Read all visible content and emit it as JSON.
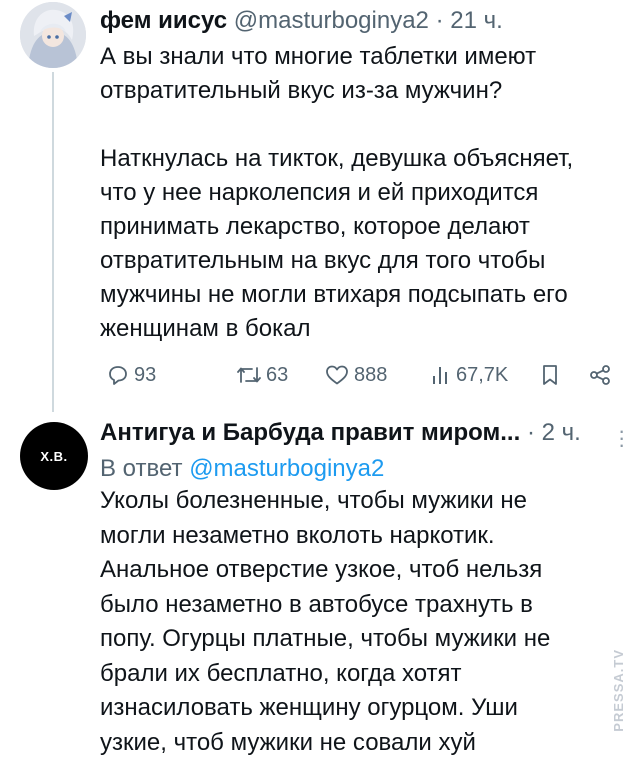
{
  "tweet1": {
    "author_name": "фем иисус",
    "meta": "@masturboginya2 · 21 ч.",
    "text": "А вы знали что многие таблетки имеют\nотвратительный вкус из-за мужчин?\n\nНаткнулась на тикток, девушка объясняет,\nчто у нее нарколепсия и ей приходится\nпринимать лекарство, которое делают\nотвратительным на вкус для того чтобы\nмужчины не могли втихаря подсыпать его\nженщинам в бокал",
    "actions": {
      "replies": "93",
      "retweets": "63",
      "likes": "888",
      "views": "67,7K"
    }
  },
  "tweet2": {
    "avatar_text": "Х.В.",
    "author_name": "Антигуа и Барбуда правит миром...",
    "meta": " · 2 ч.",
    "reply_prefix": "В ответ ",
    "reply_handle": "@masturboginya2",
    "text": "Уколы болезненные, чтобы мужики не\nмогли незаметно вколоть наркотик.\nАнальное отверстие узкое, чтоб нельзя\nбыло незаметно в автобусе трахнуть в\nпопу. Огурцы платные, чтобы мужики не\nбрали их бесплатно, когда хотят\nизнасиловать женщину огурцом. Уши\nузкие, чтоб мужики не совали хуй"
  },
  "watermark": "PRESSA.TV",
  "colors": {
    "text": "#0f1419",
    "secondary": "#536471",
    "link": "#1d9bf0"
  }
}
